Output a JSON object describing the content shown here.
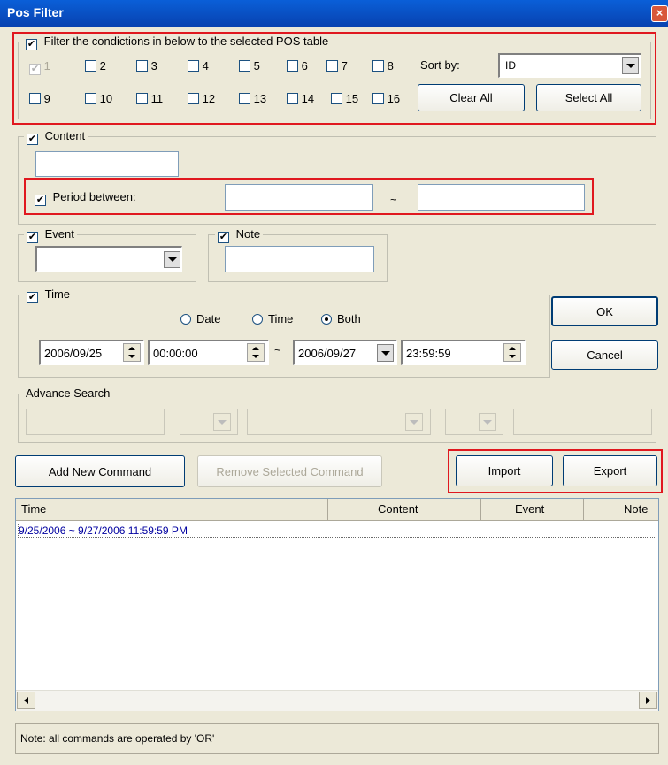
{
  "window": {
    "title": "Pos Filter",
    "close_glyph": "×"
  },
  "filter_group": {
    "label": "Filter the condictions in below to the selected POS table",
    "checked": true,
    "tables": [
      "1",
      "2",
      "3",
      "4",
      "5",
      "6",
      "7",
      "8",
      "9",
      "10",
      "11",
      "12",
      "13",
      "14",
      "15",
      "16"
    ],
    "sort_by_label": "Sort by:",
    "sort_by_value": "ID",
    "clear_all": "Clear All",
    "select_all": "Select All"
  },
  "content_group": {
    "label": "Content",
    "checked": true,
    "value": ""
  },
  "period": {
    "label": "Period between:",
    "checked": true,
    "from": "",
    "to": "",
    "tilde": "~"
  },
  "event_group": {
    "label": "Event",
    "checked": true,
    "value": ""
  },
  "note_group": {
    "label": "Note",
    "checked": true,
    "value": ""
  },
  "time_group": {
    "label": "Time",
    "checked": true,
    "radio_date": "Date",
    "radio_time": "Time",
    "radio_both": "Both",
    "selected_radio": "Both",
    "start_date": "2006/09/25",
    "start_time": "00:00:00",
    "tilde": "~",
    "end_date": "2006/09/27",
    "end_time": "23:59:59"
  },
  "buttons": {
    "ok": "OK",
    "cancel": "Cancel",
    "add": "Add New Command",
    "remove": "Remove Selected Command",
    "import": "Import",
    "export": "Export"
  },
  "advance_search": {
    "label": "Advance Search"
  },
  "list": {
    "columns": [
      "Time",
      "Content",
      "Event",
      "Note"
    ],
    "rows": [
      "9/25/2006 ~ 9/27/2006 11:59:59 PM"
    ]
  },
  "status": {
    "text": "Note: all commands are operated by 'OR'"
  },
  "colors": {
    "title_bar": "#0a5fd8",
    "highlight_border": "#e0181f",
    "dialog_bg": "#ece9d8",
    "row_text": "#0000a0"
  }
}
